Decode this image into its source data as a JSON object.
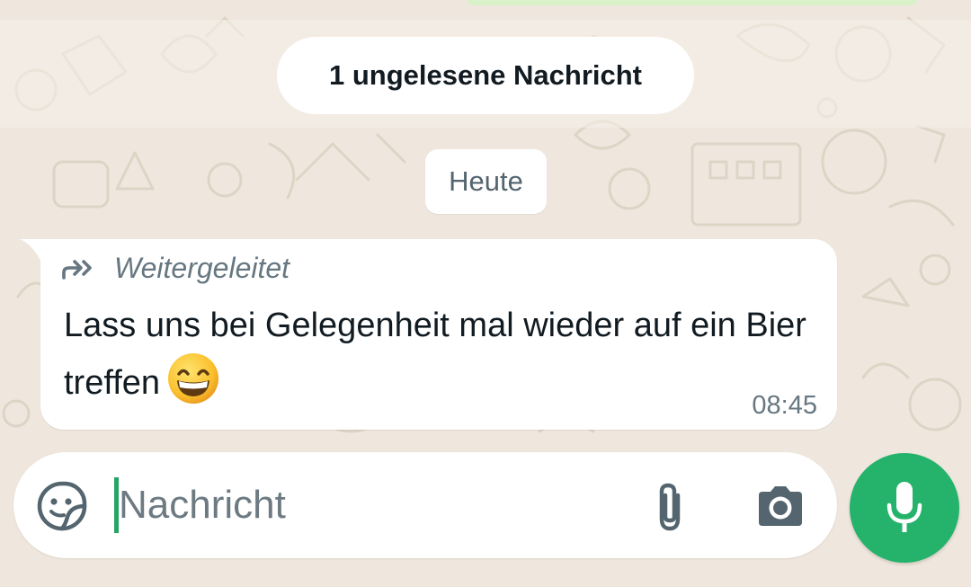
{
  "chat": {
    "unread_banner": "1 ungelesene Nachricht",
    "date_chip": "Heute",
    "messages": [
      {
        "forwarded_label": "Weitergeleitet",
        "text": "Lass uns bei Gelegenheit mal wieder auf ein Bier treffen",
        "emoji": "grinning-face-with-smiling-eyes",
        "time": "08:45"
      }
    ]
  },
  "composer": {
    "placeholder": "Nachricht",
    "value": "",
    "sticker_icon": "sticker-icon",
    "attach_icon": "paperclip-icon",
    "camera_icon": "camera-icon",
    "mic_icon": "microphone-icon"
  },
  "colors": {
    "wallpaper": "#efe7dd",
    "bubble": "#ffffff",
    "accent": "#25b36c",
    "muted_text": "#667781"
  }
}
